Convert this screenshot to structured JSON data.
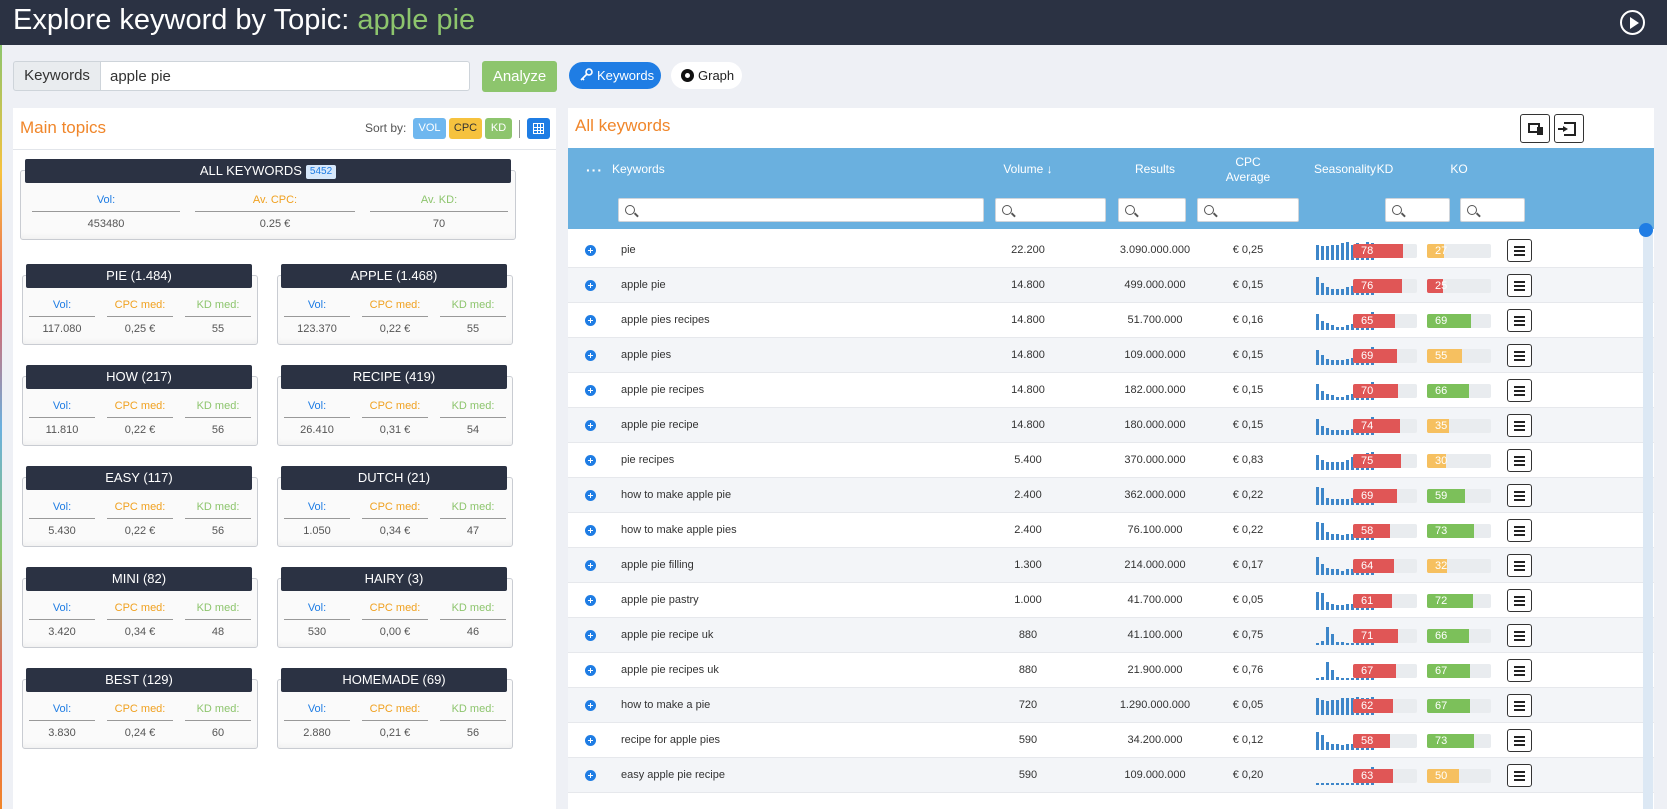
{
  "header": {
    "title_prefix": "Explore keyword by Topic:",
    "topic": "apple pie"
  },
  "search": {
    "label": "Keywords",
    "value": "apple pie",
    "analyze_label": "Analyze",
    "keywords_label": "Keywords",
    "graph_label": "Graph"
  },
  "main_topics": {
    "title": "Main topics",
    "sort_label": "Sort by:",
    "sort_vol": "VOL",
    "sort_cpc": "CPC",
    "sort_kd": "KD",
    "all": {
      "title": "ALL KEYWORDS",
      "count": "5452",
      "vol_label": "Vol:",
      "cpc_label": "Av. CPC:",
      "kd_label": "Av. KD:",
      "vol": "453480",
      "cpc": "0.25 €",
      "kd": "70"
    },
    "vol_label": "Vol:",
    "cpc_label": "CPC med:",
    "kd_label": "KD med:",
    "topics": [
      {
        "title": "PIE (1.484)",
        "vol": "117.080",
        "cpc": "0,25 €",
        "kd": "55"
      },
      {
        "title": "APPLE (1.468)",
        "vol": "123.370",
        "cpc": "0,22 €",
        "kd": "55"
      },
      {
        "title": "HOW (217)",
        "vol": "11.810",
        "cpc": "0,22 €",
        "kd": "56"
      },
      {
        "title": "RECIPE (419)",
        "vol": "26.410",
        "cpc": "0,31 €",
        "kd": "54"
      },
      {
        "title": "EASY (117)",
        "vol": "5.430",
        "cpc": "0,22 €",
        "kd": "56"
      },
      {
        "title": "DUTCH (21)",
        "vol": "1.050",
        "cpc": "0,34 €",
        "kd": "47"
      },
      {
        "title": "MINI (82)",
        "vol": "3.420",
        "cpc": "0,34 €",
        "kd": "48"
      },
      {
        "title": "HAIRY (3)",
        "vol": "530",
        "cpc": "0,00 €",
        "kd": "46"
      },
      {
        "title": "BEST (129)",
        "vol": "3.830",
        "cpc": "0,24 €",
        "kd": "60"
      },
      {
        "title": "HOMEMADE (69)",
        "vol": "2.880",
        "cpc": "0,21 €",
        "kd": "56"
      }
    ]
  },
  "all_keywords": {
    "title": "All keywords",
    "columns": {
      "dots": "···",
      "keywords": "Keywords",
      "volume": "Volume ↓",
      "results": "Results",
      "cpc_line1": "CPC",
      "cpc_line2": "Average",
      "seasonality": "Seasonality",
      "kd": "KD",
      "ko": "KO"
    },
    "colors": {
      "red": "#e05656",
      "orange": "#f6c060",
      "green": "#7cc05a"
    },
    "rows": [
      {
        "keyword": "pie",
        "volume": "22.200",
        "results": "3.090.000.000",
        "cpc": "€ 0,25",
        "kd": 78,
        "ko": 27,
        "kd_color": "red",
        "ko_color": "orange",
        "season": [
          10,
          9,
          9,
          10,
          10,
          11,
          12,
          10,
          11,
          9,
          12,
          11
        ]
      },
      {
        "keyword": "apple pie",
        "volume": "14.800",
        "results": "499.000.000",
        "cpc": "€ 0,15",
        "kd": 76,
        "ko": 25,
        "kd_color": "red",
        "ko_color": "red",
        "season": [
          14,
          9,
          6,
          5,
          5,
          5,
          6,
          7,
          7,
          7,
          7,
          8
        ]
      },
      {
        "keyword": "apple pies recipes",
        "volume": "14.800",
        "results": "51.700.000",
        "cpc": "€ 0,16",
        "kd": 65,
        "ko": 69,
        "kd_color": "red",
        "ko_color": "green",
        "season": [
          14,
          8,
          6,
          4,
          3,
          3,
          4,
          5,
          5,
          6,
          7,
          16
        ]
      },
      {
        "keyword": "apple pies",
        "volume": "14.800",
        "results": "109.000.000",
        "cpc": "€ 0,15",
        "kd": 69,
        "ko": 55,
        "kd_color": "red",
        "ko_color": "orange",
        "season": [
          14,
          9,
          6,
          5,
          5,
          5,
          6,
          7,
          7,
          7,
          7,
          17
        ]
      },
      {
        "keyword": "apple pie recipes",
        "volume": "14.800",
        "results": "182.000.000",
        "cpc": "€ 0,15",
        "kd": 70,
        "ko": 66,
        "kd_color": "red",
        "ko_color": "green",
        "season": [
          14,
          8,
          5,
          4,
          3,
          3,
          4,
          5,
          6,
          6,
          8,
          16
        ]
      },
      {
        "keyword": "apple pie recipe",
        "volume": "14.800",
        "results": "180.000.000",
        "cpc": "€ 0,15",
        "kd": 74,
        "ko": 35,
        "kd_color": "red",
        "ko_color": "orange",
        "season": [
          14,
          8,
          6,
          4,
          4,
          4,
          4,
          5,
          5,
          6,
          7,
          16
        ]
      },
      {
        "keyword": "pie recipes",
        "volume": "5.400",
        "results": "370.000.000",
        "cpc": "€ 0,83",
        "kd": 75,
        "ko": 30,
        "kd_color": "red",
        "ko_color": "orange",
        "season": [
          12,
          8,
          6,
          6,
          6,
          6,
          8,
          10,
          11,
          12,
          13,
          14
        ]
      },
      {
        "keyword": "how to make apple pie",
        "volume": "2.400",
        "results": "362.000.000",
        "cpc": "€ 0,22",
        "kd": 69,
        "ko": 59,
        "kd_color": "red",
        "ko_color": "green",
        "season": [
          15,
          14,
          6,
          5,
          5,
          5,
          5,
          6,
          6,
          7,
          7,
          8
        ]
      },
      {
        "keyword": "how to make apple pies",
        "volume": "2.400",
        "results": "76.100.000",
        "cpc": "€ 0,22",
        "kd": 58,
        "ko": 73,
        "kd_color": "red",
        "ko_color": "green",
        "season": [
          14,
          13,
          6,
          5,
          5,
          4,
          5,
          5,
          6,
          6,
          7,
          8
        ]
      },
      {
        "keyword": "apple pie filling",
        "volume": "1.300",
        "results": "214.000.000",
        "cpc": "€ 0,17",
        "kd": 64,
        "ko": 32,
        "kd_color": "red",
        "ko_color": "orange",
        "season": [
          13,
          8,
          5,
          4,
          4,
          3,
          4,
          4,
          5,
          5,
          6,
          7
        ]
      },
      {
        "keyword": "apple pie pastry",
        "volume": "1.000",
        "results": "41.700.000",
        "cpc": "€ 0,05",
        "kd": 61,
        "ko": 72,
        "kd_color": "red",
        "ko_color": "green",
        "season": [
          15,
          14,
          7,
          5,
          4,
          4,
          5,
          5,
          6,
          6,
          7,
          8
        ]
      },
      {
        "keyword": "apple pie recipe uk",
        "volume": "880",
        "results": "41.100.000",
        "cpc": "€ 0,75",
        "kd": 71,
        "ko": 66,
        "kd_color": "red",
        "ko_color": "green",
        "season": [
          2,
          4,
          17,
          10,
          3,
          3,
          2,
          2,
          2,
          2,
          2,
          2
        ]
      },
      {
        "keyword": "apple pie recipes uk",
        "volume": "880",
        "results": "21.900.000",
        "cpc": "€ 0,76",
        "kd": 67,
        "ko": 67,
        "kd_color": "red",
        "ko_color": "green",
        "season": [
          2,
          3,
          16,
          9,
          3,
          2,
          2,
          2,
          2,
          2,
          2,
          2
        ]
      },
      {
        "keyword": "how to make a pie",
        "volume": "720",
        "results": "1.290.000.000",
        "cpc": "€ 0,05",
        "kd": 62,
        "ko": 67,
        "kd_color": "red",
        "ko_color": "green",
        "season": [
          12,
          11,
          10,
          11,
          11,
          12,
          12,
          12,
          13,
          12,
          12,
          13
        ]
      },
      {
        "keyword": "recipe for apple pies",
        "volume": "590",
        "results": "34.200.000",
        "cpc": "€ 0,12",
        "kd": 58,
        "ko": 73,
        "kd_color": "red",
        "ko_color": "green",
        "season": [
          14,
          12,
          6,
          5,
          5,
          4,
          5,
          5,
          6,
          6,
          7,
          8
        ]
      },
      {
        "keyword": "easy apple pie recipe",
        "volume": "590",
        "results": "109.000.000",
        "cpc": "€ 0,20",
        "kd": 63,
        "ko": 50,
        "kd_color": "red",
        "ko_color": "orange",
        "season": [
          2,
          2,
          2,
          2,
          2,
          2,
          2,
          2,
          2,
          2,
          2,
          16
        ]
      }
    ]
  }
}
